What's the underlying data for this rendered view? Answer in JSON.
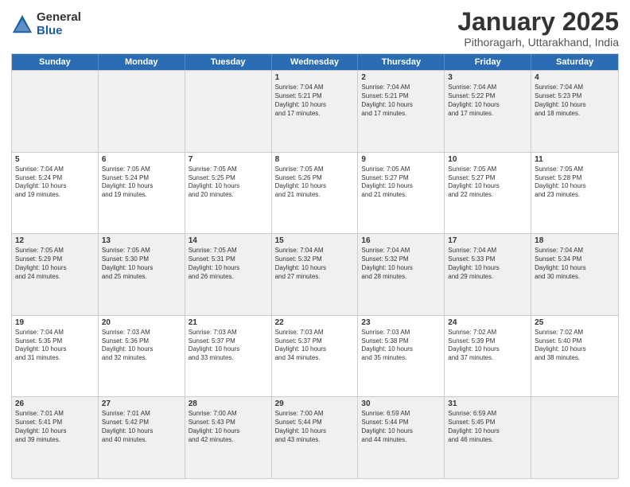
{
  "header": {
    "logo_general": "General",
    "logo_blue": "Blue",
    "month_title": "January 2025",
    "subtitle": "Pithoragarh, Uttarakhand, India"
  },
  "weekdays": [
    "Sunday",
    "Monday",
    "Tuesday",
    "Wednesday",
    "Thursday",
    "Friday",
    "Saturday"
  ],
  "rows": [
    [
      {
        "day": "",
        "text": ""
      },
      {
        "day": "",
        "text": ""
      },
      {
        "day": "",
        "text": ""
      },
      {
        "day": "1",
        "text": "Sunrise: 7:04 AM\nSunset: 5:21 PM\nDaylight: 10 hours\nand 17 minutes."
      },
      {
        "day": "2",
        "text": "Sunrise: 7:04 AM\nSunset: 5:21 PM\nDaylight: 10 hours\nand 17 minutes."
      },
      {
        "day": "3",
        "text": "Sunrise: 7:04 AM\nSunset: 5:22 PM\nDaylight: 10 hours\nand 17 minutes."
      },
      {
        "day": "4",
        "text": "Sunrise: 7:04 AM\nSunset: 5:23 PM\nDaylight: 10 hours\nand 18 minutes."
      }
    ],
    [
      {
        "day": "5",
        "text": "Sunrise: 7:04 AM\nSunset: 5:24 PM\nDaylight: 10 hours\nand 19 minutes."
      },
      {
        "day": "6",
        "text": "Sunrise: 7:05 AM\nSunset: 5:24 PM\nDaylight: 10 hours\nand 19 minutes."
      },
      {
        "day": "7",
        "text": "Sunrise: 7:05 AM\nSunset: 5:25 PM\nDaylight: 10 hours\nand 20 minutes."
      },
      {
        "day": "8",
        "text": "Sunrise: 7:05 AM\nSunset: 5:26 PM\nDaylight: 10 hours\nand 21 minutes."
      },
      {
        "day": "9",
        "text": "Sunrise: 7:05 AM\nSunset: 5:27 PM\nDaylight: 10 hours\nand 21 minutes."
      },
      {
        "day": "10",
        "text": "Sunrise: 7:05 AM\nSunset: 5:27 PM\nDaylight: 10 hours\nand 22 minutes."
      },
      {
        "day": "11",
        "text": "Sunrise: 7:05 AM\nSunset: 5:28 PM\nDaylight: 10 hours\nand 23 minutes."
      }
    ],
    [
      {
        "day": "12",
        "text": "Sunrise: 7:05 AM\nSunset: 5:29 PM\nDaylight: 10 hours\nand 24 minutes."
      },
      {
        "day": "13",
        "text": "Sunrise: 7:05 AM\nSunset: 5:30 PM\nDaylight: 10 hours\nand 25 minutes."
      },
      {
        "day": "14",
        "text": "Sunrise: 7:05 AM\nSunset: 5:31 PM\nDaylight: 10 hours\nand 26 minutes."
      },
      {
        "day": "15",
        "text": "Sunrise: 7:04 AM\nSunset: 5:32 PM\nDaylight: 10 hours\nand 27 minutes."
      },
      {
        "day": "16",
        "text": "Sunrise: 7:04 AM\nSunset: 5:32 PM\nDaylight: 10 hours\nand 28 minutes."
      },
      {
        "day": "17",
        "text": "Sunrise: 7:04 AM\nSunset: 5:33 PM\nDaylight: 10 hours\nand 29 minutes."
      },
      {
        "day": "18",
        "text": "Sunrise: 7:04 AM\nSunset: 5:34 PM\nDaylight: 10 hours\nand 30 minutes."
      }
    ],
    [
      {
        "day": "19",
        "text": "Sunrise: 7:04 AM\nSunset: 5:35 PM\nDaylight: 10 hours\nand 31 minutes."
      },
      {
        "day": "20",
        "text": "Sunrise: 7:03 AM\nSunset: 5:36 PM\nDaylight: 10 hours\nand 32 minutes."
      },
      {
        "day": "21",
        "text": "Sunrise: 7:03 AM\nSunset: 5:37 PM\nDaylight: 10 hours\nand 33 minutes."
      },
      {
        "day": "22",
        "text": "Sunrise: 7:03 AM\nSunset: 5:37 PM\nDaylight: 10 hours\nand 34 minutes."
      },
      {
        "day": "23",
        "text": "Sunrise: 7:03 AM\nSunset: 5:38 PM\nDaylight: 10 hours\nand 35 minutes."
      },
      {
        "day": "24",
        "text": "Sunrise: 7:02 AM\nSunset: 5:39 PM\nDaylight: 10 hours\nand 37 minutes."
      },
      {
        "day": "25",
        "text": "Sunrise: 7:02 AM\nSunset: 5:40 PM\nDaylight: 10 hours\nand 38 minutes."
      }
    ],
    [
      {
        "day": "26",
        "text": "Sunrise: 7:01 AM\nSunset: 5:41 PM\nDaylight: 10 hours\nand 39 minutes."
      },
      {
        "day": "27",
        "text": "Sunrise: 7:01 AM\nSunset: 5:42 PM\nDaylight: 10 hours\nand 40 minutes."
      },
      {
        "day": "28",
        "text": "Sunrise: 7:00 AM\nSunset: 5:43 PM\nDaylight: 10 hours\nand 42 minutes."
      },
      {
        "day": "29",
        "text": "Sunrise: 7:00 AM\nSunset: 5:44 PM\nDaylight: 10 hours\nand 43 minutes."
      },
      {
        "day": "30",
        "text": "Sunrise: 6:59 AM\nSunset: 5:44 PM\nDaylight: 10 hours\nand 44 minutes."
      },
      {
        "day": "31",
        "text": "Sunrise: 6:59 AM\nSunset: 5:45 PM\nDaylight: 10 hours\nand 46 minutes."
      },
      {
        "day": "",
        "text": ""
      }
    ]
  ]
}
